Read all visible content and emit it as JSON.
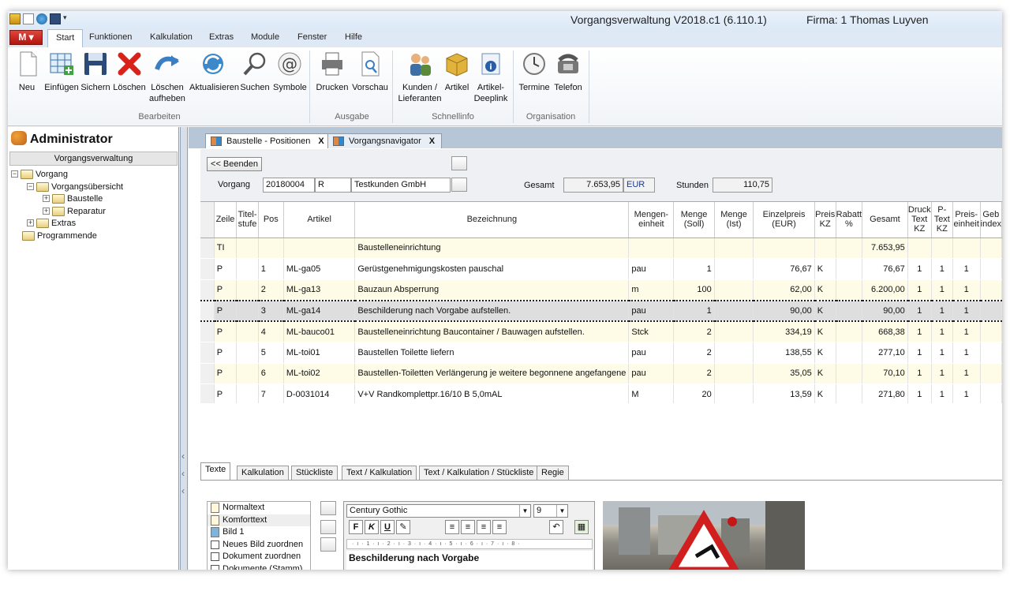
{
  "window": {
    "title": "Vorgangsverwaltung  V2018.c1 (6.110.1)",
    "company": "Firma: 1  Thomas Luyven"
  },
  "menu": {
    "app_button": "M",
    "tabs": [
      "Start",
      "Funktionen",
      "Kalkulation",
      "Extras",
      "Module",
      "Fenster",
      "Hilfe"
    ],
    "active_tab": "Start"
  },
  "ribbon": {
    "buttons": {
      "neu": "Neu",
      "einfuegen": "Einfügen",
      "sichern": "Sichern",
      "loeschen": "Löschen",
      "loeschen_aufheben_1": "Löschen",
      "loeschen_aufheben_2": "aufheben",
      "aktualisieren": "Aktualisieren",
      "suchen": "Suchen",
      "symbole": "Symbole",
      "drucken": "Drucken",
      "vorschau": "Vorschau",
      "kunden_1": "Kunden /",
      "kunden_2": "Lieferanten",
      "artikel": "Artikel",
      "deeplink_1": "Artikel-",
      "deeplink_2": "Deeplink",
      "termine": "Termine",
      "telefon": "Telefon"
    },
    "groups": {
      "bearbeiten": "Bearbeiten",
      "ausgabe": "Ausgabe",
      "schnellinfo": "Schnellinfo",
      "organisation": "Organisation"
    }
  },
  "sidebar": {
    "user": "Administrator",
    "section": "Vorgangsverwaltung",
    "tree": {
      "vorgang": "Vorgang",
      "uebersicht": "Vorgangsübersicht",
      "baustelle": "Baustelle",
      "reparatur": "Reparatur",
      "extras": "Extras",
      "programmende": "Programmende"
    }
  },
  "doc_tabs": {
    "tab1": "Baustelle - Positionen",
    "tab2": "Vorgangsnavigator",
    "close": "X"
  },
  "header": {
    "back_button": "<< Beenden",
    "vorgang_label": "Vorgang",
    "vorgang_nr": "20180004",
    "vorgang_typ": "R",
    "kunde": "Testkunden GmbH",
    "gesamt_label": "Gesamt",
    "gesamt_value": "7.653,95",
    "currency": "EUR",
    "stunden_label": "Stunden",
    "stunden_value": "110,75"
  },
  "table": {
    "columns": [
      "Zeile",
      "Titel-stufe",
      "Pos",
      "Artikel",
      "Bezeichnung",
      "Mengen-einheit",
      "Menge (Soll)",
      "Menge (Ist)",
      "Einzelpreis (EUR)",
      "Preis KZ",
      "Rabatt %",
      "Gesamt",
      "Druck Text KZ",
      "P-Text KZ",
      "Preis-einheit",
      "Geb index"
    ],
    "rows": [
      {
        "zeile": "TI",
        "titel": "",
        "pos": "",
        "artikel": "",
        "bez": "Baustelleneinrichtung",
        "einheit": "",
        "soll": "",
        "ist": "",
        "preis": "",
        "kz": "",
        "rabatt": "",
        "gesamt": "7.653,95",
        "druck": "",
        "ptext": "",
        "pe": "",
        "geb": ""
      },
      {
        "zeile": "P",
        "titel": "",
        "pos": "1",
        "artikel": "ML-ga05",
        "bez": "Gerüstgenehmigungskosten pauschal",
        "einheit": "pau",
        "soll": "1",
        "ist": "",
        "preis": "76,67",
        "kz": "K",
        "rabatt": "",
        "gesamt": "76,67",
        "druck": "1",
        "ptext": "1",
        "pe": "1",
        "geb": ""
      },
      {
        "zeile": "P",
        "titel": "",
        "pos": "2",
        "artikel": "ML-ga13",
        "bez": "Bauzaun Absperrung",
        "einheit": "m",
        "soll": "100",
        "ist": "",
        "preis": "62,00",
        "kz": "K",
        "rabatt": "",
        "gesamt": "6.200,00",
        "druck": "1",
        "ptext": "1",
        "pe": "1",
        "geb": ""
      },
      {
        "zeile": "P",
        "titel": "",
        "pos": "3",
        "artikel": "ML-ga14",
        "bez": "Beschilderung nach Vorgabe aufstellen.",
        "einheit": "pau",
        "soll": "1",
        "ist": "",
        "preis": "90,00",
        "kz": "K",
        "rabatt": "",
        "gesamt": "90,00",
        "druck": "1",
        "ptext": "1",
        "pe": "1",
        "geb": ""
      },
      {
        "zeile": "P",
        "titel": "",
        "pos": "4",
        "artikel": "ML-bauco01",
        "bez": "Baustelleneinrichtung Baucontainer / Bauwagen aufstellen.",
        "einheit": "Stck",
        "soll": "2",
        "ist": "",
        "preis": "334,19",
        "kz": "K",
        "rabatt": "",
        "gesamt": "668,38",
        "druck": "1",
        "ptext": "1",
        "pe": "1",
        "geb": ""
      },
      {
        "zeile": "P",
        "titel": "",
        "pos": "5",
        "artikel": "ML-toi01",
        "bez": "Baustellen Toilette liefern",
        "einheit": "pau",
        "soll": "2",
        "ist": "",
        "preis": "138,55",
        "kz": "K",
        "rabatt": "",
        "gesamt": "277,10",
        "druck": "1",
        "ptext": "1",
        "pe": "1",
        "geb": ""
      },
      {
        "zeile": "P",
        "titel": "",
        "pos": "6",
        "artikel": "ML-toi02",
        "bez": "Baustellen-Toiletten Verlängerung je weitere begonnene angefangene",
        "einheit": "pau",
        "soll": "2",
        "ist": "",
        "preis": "35,05",
        "kz": "K",
        "rabatt": "",
        "gesamt": "70,10",
        "druck": "1",
        "ptext": "1",
        "pe": "1",
        "geb": ""
      },
      {
        "zeile": "P",
        "titel": "",
        "pos": "7",
        "artikel": "D-0031014",
        "bez": "V+V Randkomplettpr.16/10 B 5,0mAL",
        "einheit": "M",
        "soll": "20",
        "ist": "",
        "preis": "13,59",
        "kz": "K",
        "rabatt": "",
        "gesamt": "271,80",
        "druck": "1",
        "ptext": "1",
        "pe": "1",
        "geb": ""
      }
    ]
  },
  "bottom_tabs": [
    "Texte",
    "Kalkulation",
    "Stückliste",
    "Text / Kalkulation",
    "Text / Kalkulation / Stückliste",
    "Regie"
  ],
  "text_list": {
    "items": [
      "Normaltext",
      "Komforttext",
      "Bild 1",
      "Neues Bild zuordnen",
      "Dokument zuordnen",
      "Dokumente (Stamm)"
    ]
  },
  "editor": {
    "font": "Century Gothic",
    "size": "9",
    "bold": "F",
    "italic": "K",
    "underline": "U",
    "ruler": "· ı · 1 · ı · 2 · ı · 3 · ı · 4 · ı · 5 · ı · 6 · ı · 7 · ı · 8 ·",
    "text": "Beschilderung nach Vorgabe"
  }
}
